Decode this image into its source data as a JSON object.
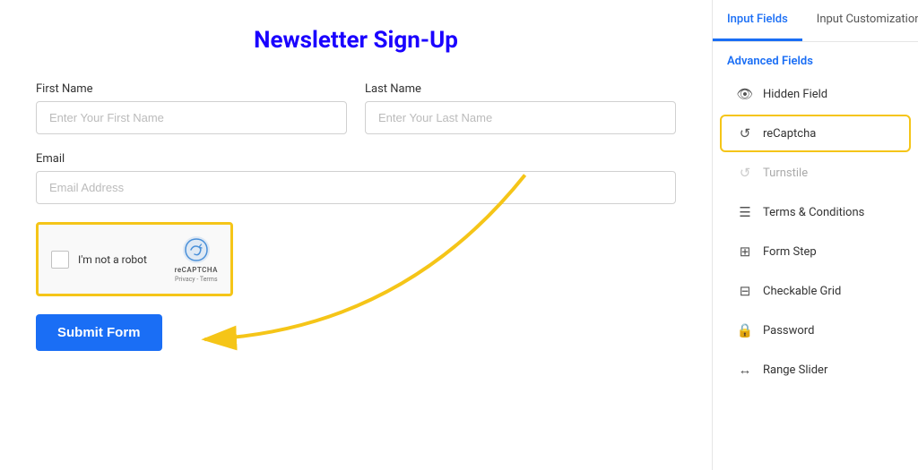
{
  "form": {
    "title": "Newsletter Sign-Up",
    "fields": {
      "firstName": {
        "label": "First Name",
        "placeholder": "Enter Your First Name"
      },
      "lastName": {
        "label": "Last Name",
        "placeholder": "Enter Your Last Name"
      },
      "email": {
        "label": "Email",
        "placeholder": "Email Address"
      }
    },
    "recaptcha": {
      "label": "I'm not a robot",
      "brand": "reCAPTCHA",
      "links": "Privacy - Terms"
    },
    "submit": "Submit Form"
  },
  "panel": {
    "tabs": [
      {
        "label": "Input Fields",
        "active": true
      },
      {
        "label": "Input Customization",
        "active": false
      }
    ],
    "section_title": "Advanced Fields",
    "items": [
      {
        "icon": "👁",
        "label": "Hidden Field",
        "highlighted": false,
        "disabled": false
      },
      {
        "icon": "↺",
        "label": "reCaptcha",
        "highlighted": true,
        "disabled": false
      },
      {
        "icon": "↺",
        "label": "Turnstile",
        "highlighted": false,
        "disabled": true
      },
      {
        "icon": "☰",
        "label": "Terms & Conditions",
        "highlighted": false,
        "disabled": false
      },
      {
        "icon": "⊞",
        "label": "Form Step",
        "highlighted": false,
        "disabled": false
      },
      {
        "icon": "⊟",
        "label": "Checkable Grid",
        "highlighted": false,
        "disabled": false
      },
      {
        "icon": "🔒",
        "label": "Password",
        "highlighted": false,
        "disabled": false
      },
      {
        "icon": "↔",
        "label": "Range Slider",
        "highlighted": false,
        "disabled": false
      }
    ]
  }
}
